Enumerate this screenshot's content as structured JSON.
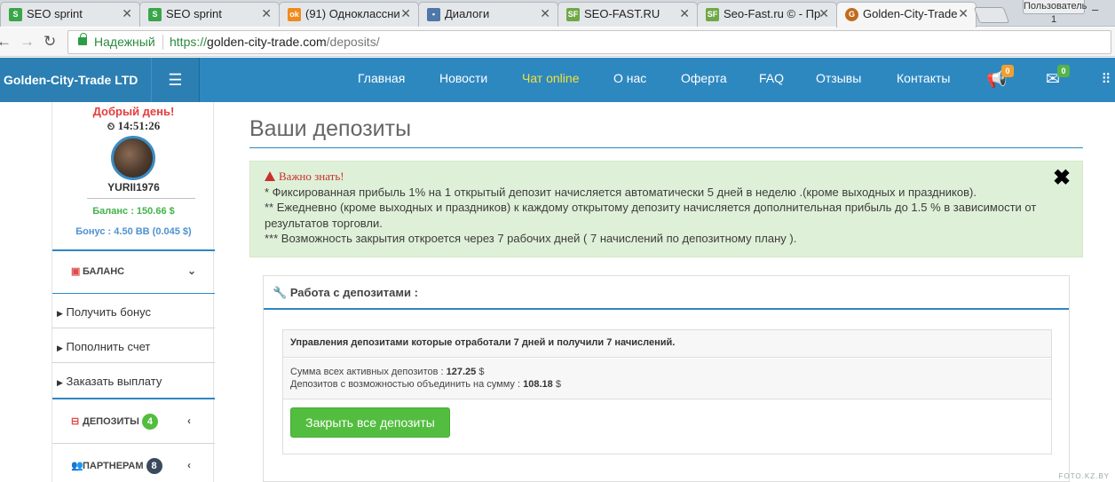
{
  "browser": {
    "tabs": [
      {
        "title": "SEO sprint",
        "icon": "seosprint-favicon",
        "color": "#3aa64a"
      },
      {
        "title": "SEO sprint",
        "icon": "seosprint-favicon",
        "color": "#3aa64a"
      },
      {
        "title": "(91) Одноклассни",
        "icon": "odnoklassniki-favicon",
        "color": "#f08a1c"
      },
      {
        "title": "Диалоги",
        "icon": "vk-dialogs-favicon",
        "color": "#4f77a8"
      },
      {
        "title": "SEO-FAST.RU",
        "icon": "seofast-favicon",
        "color": "#6fa848"
      },
      {
        "title": "Seo-Fast.ru © - Пр",
        "icon": "seofast-favicon",
        "color": "#6fa848"
      },
      {
        "title": "Golden-City-Trade",
        "icon": "gct-favicon",
        "color": "#c26a1c"
      }
    ],
    "user_button": "Пользователь 1",
    "secure_label": "Надежный",
    "url_scheme": "https://",
    "url_host": "golden-city-trade.com",
    "url_path": "/deposits/"
  },
  "site": {
    "brand": "Golden-City-Trade LTD",
    "nav": [
      "Главная",
      "Новости",
      "Чат online",
      "О нас",
      "Оферта",
      "FAQ",
      "Отзывы",
      "Контакты"
    ],
    "nav_highlight_color": "#f3e23a",
    "notif_count": "0",
    "mail_count": "0"
  },
  "sidebar": {
    "greeting": "Добрый день!",
    "time": "14:51:26",
    "username": "YURII1976",
    "balance": "Баланс : 150.66 $",
    "bonus": "Бонус : 4.50 BB (0.045 $)",
    "balance_section": "БАЛАНС",
    "items": [
      "Получить бонус",
      "Пополнить счет",
      "Заказать выплату"
    ],
    "deposits_section": "ДЕПОЗИТЫ",
    "deposits_count": "4",
    "partners_section": "ПАРТНЕРАМ",
    "partners_count": "8"
  },
  "main": {
    "title": "Ваши депозиты",
    "alert": {
      "heading": "Важно знать!",
      "lines": [
        "* Фиксированная прибыль 1% на 1 открытый депозит начисляется автоматически 5 дней в неделю .(кроме выходных и праздников).",
        "** Ежедневно (кроме выходных и праздников) к каждому открытому депозиту начисляется дополнительная прибыль до 1.5 % в зависимости от результатов торговли.",
        "*** Возможность закрытия откроется через 7 рабочих дней ( 7 начислений по депозитному плану )."
      ]
    },
    "panel": {
      "title": "Работа с депозитами :",
      "row_title": "Управления депозитами которые отработали 7 дней и получили 7 начислений.",
      "sum_label": "Сумма всех активных депозитов :",
      "sum_value": "127.25",
      "merge_label": "Депозитов с возможностью объединить на сумму :",
      "merge_value": "108.18",
      "currency": "$",
      "button": "Закрыть все депозиты"
    }
  },
  "watermark": "FOTO.KZ.BY"
}
